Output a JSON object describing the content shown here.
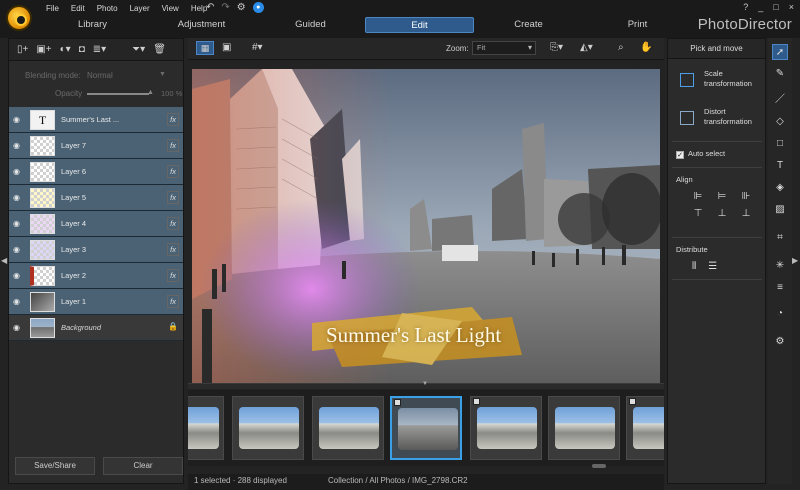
{
  "menu": [
    "File",
    "Edit",
    "Photo",
    "Layer",
    "View",
    "Help"
  ],
  "titlebar_icons": [
    "undo-icon",
    "redo-icon",
    "gear-icon",
    "account-icon"
  ],
  "window_controls": [
    "?",
    "_",
    "□",
    "×"
  ],
  "mode_tabs": [
    {
      "label": "Library",
      "active": false
    },
    {
      "label": "Adjustment",
      "active": false
    },
    {
      "label": "Guided",
      "active": false
    },
    {
      "label": "Edit",
      "active": true
    },
    {
      "label": "Create",
      "active": false
    },
    {
      "label": "Print",
      "active": false
    }
  ],
  "brand": "PhotoDirector",
  "layers_panel": {
    "blending_label": "Blending mode:",
    "blending_value": "Normal",
    "opacity_label": "Opacity",
    "opacity_value": "100 %",
    "opacity_level": 1.0,
    "layers": [
      {
        "name": "Summer's Last ...",
        "thumb": "text",
        "selected": true,
        "fx": "fx"
      },
      {
        "name": "Layer 7",
        "thumb": "checker",
        "selected": true,
        "fx": "fx"
      },
      {
        "name": "Layer 6",
        "thumb": "checker",
        "selected": true,
        "fx": "fx"
      },
      {
        "name": "Layer 5",
        "thumb": "checker",
        "selected": true,
        "fx": "fx"
      },
      {
        "name": "Layer 4",
        "thumb": "checker",
        "selected": true,
        "fx": "fx"
      },
      {
        "name": "Layer 3",
        "thumb": "checker",
        "selected": true,
        "fx": "fx"
      },
      {
        "name": "Layer 2",
        "thumb": "checker",
        "selected": true,
        "fx": "fx"
      },
      {
        "name": "Layer 1",
        "thumb": "checker",
        "selected": true,
        "fx": "fx"
      },
      {
        "name": "Background",
        "thumb": "photo",
        "selected": false,
        "locked": true
      }
    ],
    "save_share_label": "Save/Share",
    "clear_label": "Clear"
  },
  "view_toolbar": {
    "zoom_label": "Zoom:",
    "zoom_value": "Fit"
  },
  "canvas": {
    "overlay_text": "Summer's Last Light"
  },
  "status": {
    "selection": "1 selected · 288 displayed",
    "path": "Collection / All Photos / IMG_2798.CR2"
  },
  "right_panel": {
    "title": "Pick and move",
    "options": [
      {
        "label": "Scale transformation",
        "active": true
      },
      {
        "label": "Distort transformation",
        "active": false
      }
    ],
    "auto_select_label": "Auto select",
    "auto_select_checked": true,
    "align_label": "Align",
    "distribute_label": "Distribute"
  },
  "colors": {
    "accent": "#2f5b8c",
    "accent_border": "#4c86c4",
    "selected_layer": "#4a6274",
    "film_selected": "#3aa0e8"
  }
}
